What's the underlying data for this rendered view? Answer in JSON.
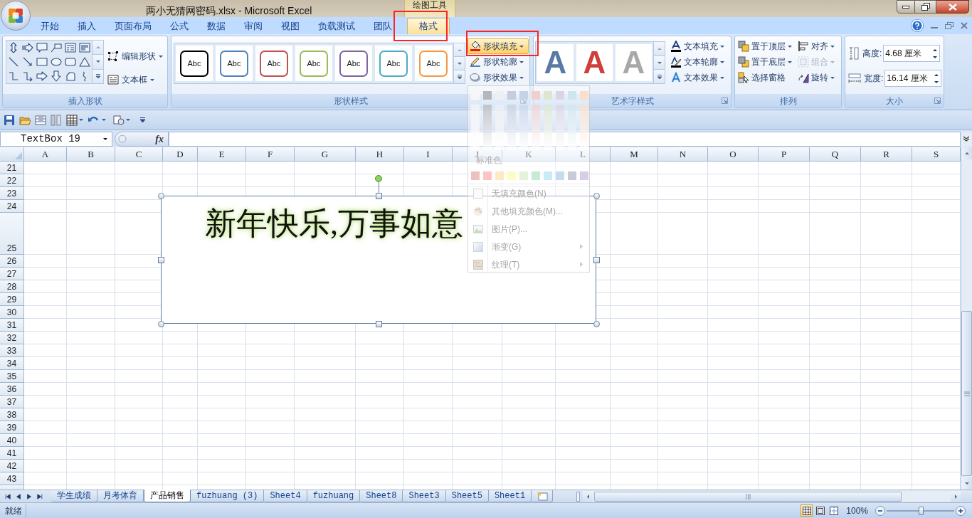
{
  "title_bar": {
    "title": "两小无猜网密码.xlsx - Microsoft Excel",
    "context_label": "绘图工具"
  },
  "ribbon_tabs": [
    {
      "label": "开始",
      "selected": false
    },
    {
      "label": "插入",
      "selected": false
    },
    {
      "label": "页面布局",
      "selected": false
    },
    {
      "label": "公式",
      "selected": false
    },
    {
      "label": "数据",
      "selected": false
    },
    {
      "label": "审阅",
      "selected": false
    },
    {
      "label": "视图",
      "selected": false
    },
    {
      "label": "负载测试",
      "selected": false
    },
    {
      "label": "团队",
      "selected": false
    },
    {
      "label": "格式",
      "selected": true
    }
  ],
  "ribbon": {
    "insert_shapes": {
      "label": "插入形状",
      "buttons": [
        "编辑形状",
        "文本框"
      ]
    },
    "shape_styles": {
      "label": "形状样式",
      "presets": [
        {
          "text": "Abc",
          "color": "#000000"
        },
        {
          "text": "Abc",
          "color": "#4f81bd"
        },
        {
          "text": "Abc",
          "color": "#c0504d"
        },
        {
          "text": "Abc",
          "color": "#9bbb59"
        },
        {
          "text": "Abc",
          "color": "#8064a2"
        },
        {
          "text": "Abc",
          "color": "#4bacc6"
        },
        {
          "text": "Abc",
          "color": "#f79646"
        }
      ],
      "buttons": [
        {
          "label": "形状填充",
          "open": true
        },
        {
          "label": "形状轮廓",
          "open": false
        },
        {
          "label": "形状效果",
          "open": false
        }
      ]
    },
    "wordart_styles": {
      "label": "艺术字样式",
      "presets": [
        {
          "text": "A",
          "color": "#5a79a5"
        },
        {
          "text": "A",
          "color": "#d0403a"
        },
        {
          "text": "A",
          "color": "#a8a8a8"
        }
      ],
      "buttons": [
        "文本填充",
        "文本轮廓",
        "文本效果"
      ]
    },
    "arrange": {
      "label": "排列",
      "buttons": [
        {
          "label": "置于顶层",
          "has_menu": true,
          "disabled": false
        },
        {
          "label": "对齐",
          "has_menu": true,
          "disabled": false
        },
        {
          "label": "置于底层",
          "has_menu": true,
          "disabled": false
        },
        {
          "label": "组合",
          "has_menu": true,
          "disabled": true
        },
        {
          "label": "选择窗格",
          "has_menu": false,
          "disabled": false
        },
        {
          "label": "旋转",
          "has_menu": true,
          "disabled": false
        }
      ]
    },
    "size": {
      "label": "大小",
      "fields": [
        {
          "label": "高度:",
          "value": "4.68 厘米"
        },
        {
          "label": "宽度:",
          "value": "16.14 厘米"
        }
      ]
    }
  },
  "formula_bar": {
    "name_box": "TextBox 19",
    "function_label": "fx"
  },
  "sheet": {
    "columns": [
      "A",
      "B",
      "C",
      "D",
      "E",
      "F",
      "G",
      "H",
      "I",
      "J",
      "K",
      "L",
      "M",
      "N",
      "O",
      "P",
      "Q",
      "R",
      "S"
    ],
    "rows": [
      "21",
      "22",
      "23",
      "24",
      "25",
      "26",
      "27",
      "28",
      "29",
      "30",
      "31",
      "32",
      "33",
      "34",
      "35",
      "36",
      "37",
      "38",
      "39",
      "40",
      "41",
      "42",
      "43"
    ],
    "text_box": {
      "text": "新年快乐,万事如意",
      "selected": true
    }
  },
  "fill_menu": {
    "theme_colors": [
      {
        "color": "#f7f7f7"
      },
      {
        "color": "#b3b6ba"
      },
      {
        "color": "#eceff3"
      },
      {
        "color": "#c3cddd"
      },
      {
        "color": "#c5d3e8"
      },
      {
        "color": "#f0cfcd"
      },
      {
        "color": "#dde7cf"
      },
      {
        "color": "#dad4e5"
      },
      {
        "color": "#cfe5ee"
      },
      {
        "color": "#fbdfca"
      }
    ],
    "heading": "标准色",
    "standard_colors": [
      {
        "color": "#efc0c0"
      },
      {
        "color": "#fdc4c4"
      },
      {
        "color": "#fdebc0"
      },
      {
        "color": "#fdfcc2"
      },
      {
        "color": "#e5f2d6"
      },
      {
        "color": "#c6ebd5"
      },
      {
        "color": "#c7ecf8"
      },
      {
        "color": "#c5dbee"
      },
      {
        "color": "#c7cbd6"
      },
      {
        "color": "#d9cce7"
      }
    ],
    "items": [
      {
        "label": "无填充颜色(N)",
        "kind": "no-fill",
        "submenu": false
      },
      {
        "label": "其他填充颜色(M)...",
        "kind": "palette",
        "submenu": false
      },
      {
        "label": "图片(P)...",
        "kind": "picture",
        "submenu": false
      },
      {
        "label": "渐变(G)",
        "kind": "gradient",
        "submenu": true
      },
      {
        "label": "纹理(T)",
        "kind": "texture",
        "submenu": true
      }
    ]
  },
  "sheet_tabs": [
    {
      "label": "学生成绩",
      "selected": false
    },
    {
      "label": "月考体育",
      "selected": false
    },
    {
      "label": "产品销售",
      "selected": true
    },
    {
      "label": "fuzhuang (3)",
      "selected": false
    },
    {
      "label": "Sheet4",
      "selected": false
    },
    {
      "label": "fuzhuang",
      "selected": false
    },
    {
      "label": "Sheet8",
      "selected": false
    },
    {
      "label": "Sheet3",
      "selected": false
    },
    {
      "label": "Sheet5",
      "selected": false
    },
    {
      "label": "Sheet1",
      "selected": false
    }
  ],
  "status_bar": {
    "status": "就绪",
    "view_buttons": [
      {
        "kind": "normal",
        "selected": true
      },
      {
        "kind": "page-layout",
        "selected": false
      },
      {
        "kind": "page-break",
        "selected": false
      }
    ],
    "zoom": "100%",
    "zoom_slider": {
      "level": 0.5
    }
  }
}
